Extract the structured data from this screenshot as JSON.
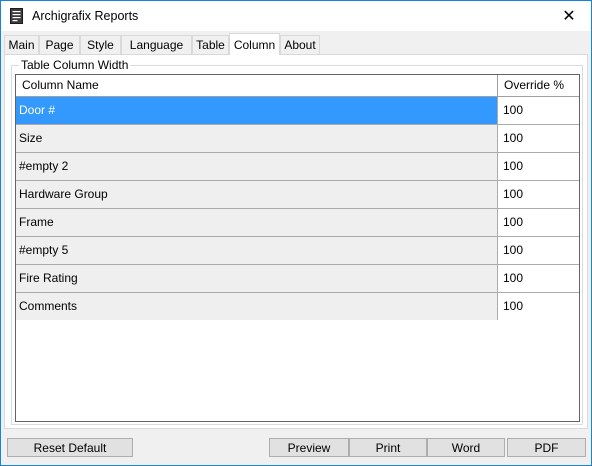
{
  "window": {
    "title": "Archigrafix Reports",
    "close_glyph": "✕"
  },
  "tabs": [
    {
      "label": "Main",
      "active": false
    },
    {
      "label": "Page",
      "active": false
    },
    {
      "label": "Style",
      "active": false
    },
    {
      "label": "Language",
      "active": false
    },
    {
      "label": "Table",
      "active": false
    },
    {
      "label": "Column",
      "active": true
    },
    {
      "label": "About",
      "active": false
    }
  ],
  "group": {
    "legend": "Table Column Width"
  },
  "grid": {
    "headers": {
      "name": "Column Name",
      "override": "Override %"
    },
    "rows": [
      {
        "name": "Door #",
        "override": "100",
        "selected": true
      },
      {
        "name": "Size",
        "override": "100",
        "selected": false
      },
      {
        "name": "#empty 2",
        "override": "100",
        "selected": false
      },
      {
        "name": "Hardware Group",
        "override": "100",
        "selected": false
      },
      {
        "name": "Frame",
        "override": "100",
        "selected": false
      },
      {
        "name": "#empty 5",
        "override": "100",
        "selected": false
      },
      {
        "name": "Fire Rating",
        "override": "100",
        "selected": false
      },
      {
        "name": "Comments",
        "override": "100",
        "selected": false
      }
    ]
  },
  "buttons": {
    "reset": "Reset Default",
    "preview": "Preview",
    "print": "Print",
    "word": "Word",
    "pdf": "PDF"
  },
  "colors": {
    "selection": "#3399ff",
    "window_border": "#1883d7"
  }
}
